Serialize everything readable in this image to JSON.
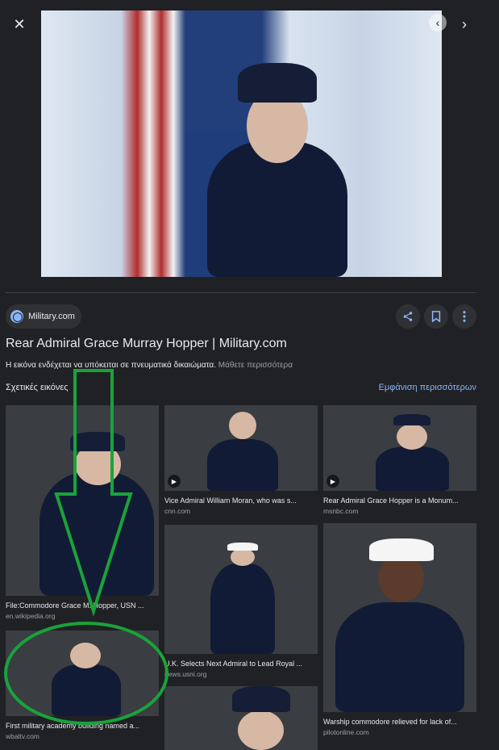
{
  "header": {
    "close_label": "✕",
    "prev_label": "‹",
    "next_label": "›"
  },
  "source": {
    "name": "Military.com"
  },
  "actions": {
    "share_icon": "share-icon",
    "save_icon": "bookmark-icon",
    "more_icon": "more-vert-icon"
  },
  "title": "Rear Admiral Grace Murray Hopper | Military.com",
  "copyright": {
    "text": "Η εικόνα ενδέχεται να υπόκειται σε πνευματικά δικαιώματα.",
    "link": "Μάθετε περισσότερα"
  },
  "related": {
    "label": "Σχετικές εικόνες",
    "show_more": "Εμφάνιση περισσότερων",
    "items": [
      {
        "caption": "File:Commodore Grace M. Hopper, USN ...",
        "site": "en.wikipedia.org"
      },
      {
        "caption": "First military academy building named a...",
        "site": "wbaltv.com"
      },
      {
        "caption": "Vice Admiral William Moran, who was s...",
        "site": "cnn.com"
      },
      {
        "caption": "U.K. Selects Next Admiral to Lead Royal ...",
        "site": "news.usni.org"
      },
      {
        "caption": "Rear Admiral Grace Hopper is a Monum...",
        "site": "msnbc.com"
      },
      {
        "caption": "Warship commodore relieved for lack of...",
        "site": "pilotonline.com"
      }
    ]
  },
  "colors": {
    "annotation_green": "#19a33a",
    "link_blue": "#8ab4f8",
    "background": "#202124"
  }
}
